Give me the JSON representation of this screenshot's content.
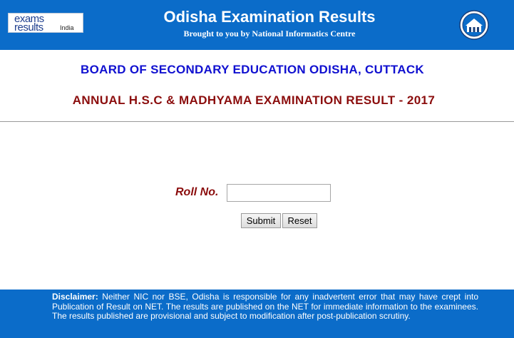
{
  "header": {
    "logo": {
      "line1": "exams",
      "line2": "results",
      "region": "India"
    },
    "title": "Odisha Examination Results",
    "subtitle": "Brought to you by National Informatics Centre",
    "emblem_icon": "nic-emblem-icon"
  },
  "main": {
    "board": "BOARD OF SECONDARY EDUCATION ODISHA, CUTTACK",
    "exam": "ANNUAL H.S.C & MADHYAMA EXAMINATION RESULT - 2017"
  },
  "form": {
    "roll_label": "Roll No.",
    "roll_value": "",
    "submit_label": "Submit",
    "reset_label": "Reset"
  },
  "footer": {
    "disclaimer_label": "Disclaimer:",
    "disclaimer_text": " Neither NIC nor BSE, Odisha is responsible for any inadvertent error that may have crept into Publication of Result on NET. The results are published on the NET for immediate information to the examinees. The results published are provisional and subject to modification after post-publication scrutiny."
  },
  "colors": {
    "header_bg": "#0b6cc9",
    "board_text": "#1010d0",
    "exam_text": "#8b0d0d",
    "label_text": "#8b0d0d"
  }
}
